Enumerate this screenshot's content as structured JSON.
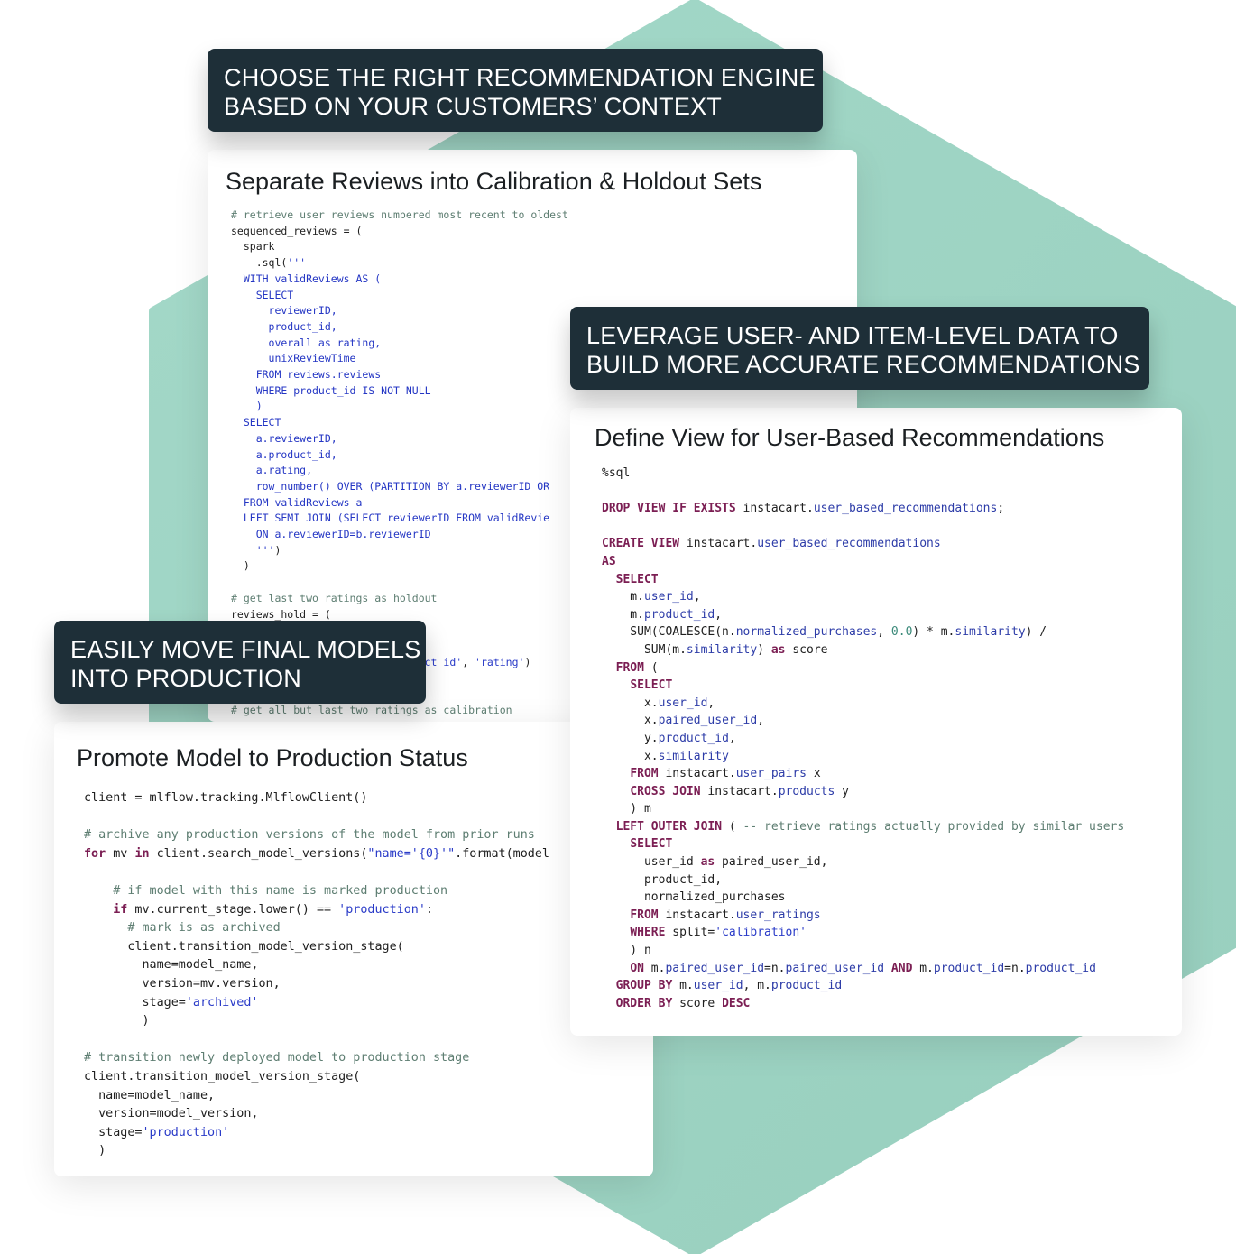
{
  "colors": {
    "hexagon": "#9dd3c3",
    "label_bg": "#1e2f38",
    "label_text": "#ffffff",
    "card_bg": "#ffffff",
    "comment": "#5e7e72",
    "string": "#2a3bc8",
    "keyword": "#7b1e53",
    "identifier": "#2d3ca8"
  },
  "labels": {
    "choose_engine": [
      "CHOOSE THE RIGHT RECOMMENDATION ENGINE",
      "BASED ON YOUR CUSTOMERS’ CONTEXT"
    ],
    "leverage_data": [
      "LEVERAGE USER- AND ITEM-LEVEL DATA TO",
      "BUILD MORE ACCURATE RECOMMENDATIONS"
    ],
    "move_models": [
      "EASILY MOVE FINAL MODELS",
      "INTO PRODUCTION"
    ]
  },
  "cards": {
    "calibration": {
      "title": "Separate Reviews into Calibration & Holdout Sets",
      "lines": [
        [
          [
            "c",
            "# retrieve user reviews numbered most recent to oldest"
          ]
        ],
        [
          [
            "t",
            "sequenced_reviews = ("
          ]
        ],
        [
          [
            "t",
            "  spark"
          ]
        ],
        [
          [
            "t",
            "    .sql("
          ],
          [
            "s",
            "'''"
          ]
        ],
        [
          [
            "sql",
            "  WITH validReviews AS ("
          ]
        ],
        [
          [
            "sql",
            "    SELECT"
          ]
        ],
        [
          [
            "sql",
            "      reviewerID,"
          ]
        ],
        [
          [
            "sql",
            "      product_id,"
          ]
        ],
        [
          [
            "sql",
            "      overall as rating,"
          ]
        ],
        [
          [
            "sql",
            "      unixReviewTime"
          ]
        ],
        [
          [
            "sql",
            "    FROM reviews.reviews"
          ]
        ],
        [
          [
            "sql",
            "    WHERE product_id IS NOT NULL"
          ]
        ],
        [
          [
            "sql",
            "    )"
          ]
        ],
        [
          [
            "sql",
            "  SELECT"
          ]
        ],
        [
          [
            "sql",
            "    a.reviewerID,"
          ]
        ],
        [
          [
            "sql",
            "    a.product_id,"
          ]
        ],
        [
          [
            "sql",
            "    a.rating,"
          ]
        ],
        [
          [
            "sql",
            "    row_number() OVER (PARTITION BY a.reviewerID OR"
          ]
        ],
        [
          [
            "sql",
            "  FROM validReviews a"
          ]
        ],
        [
          [
            "sql",
            "  LEFT SEMI JOIN (SELECT reviewerID FROM validRevie"
          ]
        ],
        [
          [
            "sql",
            "    ON a.reviewerID=b.reviewerID"
          ]
        ],
        [
          [
            "s",
            "    '''"
          ],
          [
            "t",
            ")"
          ]
        ],
        [
          [
            "t",
            "  )"
          ]
        ],
        [
          [
            "t",
            ""
          ]
        ],
        [
          [
            "c",
            "# get last two ratings as holdout"
          ]
        ],
        [
          [
            "t",
            "reviews_hold = ("
          ]
        ],
        [
          [
            "t",
            ""
          ]
        ],
        [
          [
            "t",
            ""
          ]
        ],
        [
          [
            "t",
            "                         "
          ],
          [
            "s",
            "'product_id'"
          ],
          [
            "t",
            ", "
          ],
          [
            "s",
            "'rating'"
          ],
          [
            "t",
            ")"
          ]
        ],
        [
          [
            "t",
            ""
          ]
        ],
        [
          [
            "t",
            ""
          ]
        ],
        [
          [
            "c",
            "# get all but last two ratings as calibration"
          ]
        ]
      ]
    },
    "user_view": {
      "title": "Define View for User-Based Recommendations",
      "lines": [
        [
          [
            "t",
            "%sql"
          ]
        ],
        [
          [
            "t",
            ""
          ]
        ],
        [
          [
            "kw",
            "DROP VIEW IF EXISTS"
          ],
          [
            "t",
            " instacart."
          ],
          [
            "id",
            "user_based_recommendations"
          ],
          [
            "t",
            ";"
          ]
        ],
        [
          [
            "t",
            ""
          ]
        ],
        [
          [
            "kw",
            "CREATE VIEW"
          ],
          [
            "t",
            " instacart."
          ],
          [
            "id",
            "user_based_recommendations"
          ]
        ],
        [
          [
            "kw",
            "AS"
          ]
        ],
        [
          [
            "t",
            "  "
          ],
          [
            "kw",
            "SELECT"
          ]
        ],
        [
          [
            "t",
            "    m."
          ],
          [
            "id",
            "user_id"
          ],
          [
            "t",
            ","
          ]
        ],
        [
          [
            "t",
            "    m."
          ],
          [
            "id",
            "product_id"
          ],
          [
            "t",
            ","
          ]
        ],
        [
          [
            "t",
            "    SUM(COALESCE(n."
          ],
          [
            "id",
            "normalized_purchases"
          ],
          [
            "t",
            ", "
          ],
          [
            "num",
            "0.0"
          ],
          [
            "t",
            ") * m."
          ],
          [
            "id",
            "similarity"
          ],
          [
            "t",
            ") /"
          ]
        ],
        [
          [
            "t",
            "      SUM(m."
          ],
          [
            "id",
            "similarity"
          ],
          [
            "t",
            ") "
          ],
          [
            "kw",
            "as"
          ],
          [
            "t",
            " score"
          ]
        ],
        [
          [
            "t",
            "  "
          ],
          [
            "kw",
            "FROM"
          ],
          [
            "t",
            " ("
          ]
        ],
        [
          [
            "t",
            "    "
          ],
          [
            "kw",
            "SELECT"
          ]
        ],
        [
          [
            "t",
            "      x."
          ],
          [
            "id",
            "user_id"
          ],
          [
            "t",
            ","
          ]
        ],
        [
          [
            "t",
            "      x."
          ],
          [
            "id",
            "paired_user_id"
          ],
          [
            "t",
            ","
          ]
        ],
        [
          [
            "t",
            "      y."
          ],
          [
            "id",
            "product_id"
          ],
          [
            "t",
            ","
          ]
        ],
        [
          [
            "t",
            "      x."
          ],
          [
            "id",
            "similarity"
          ]
        ],
        [
          [
            "t",
            "    "
          ],
          [
            "kw",
            "FROM"
          ],
          [
            "t",
            " instacart."
          ],
          [
            "id",
            "user_pairs"
          ],
          [
            "t",
            " x"
          ]
        ],
        [
          [
            "t",
            "    "
          ],
          [
            "kw",
            "CROSS JOIN"
          ],
          [
            "t",
            " instacart."
          ],
          [
            "id",
            "products"
          ],
          [
            "t",
            " y"
          ]
        ],
        [
          [
            "t",
            "    ) m"
          ]
        ],
        [
          [
            "t",
            "  "
          ],
          [
            "kw",
            "LEFT OUTER JOIN"
          ],
          [
            "t",
            " ( "
          ],
          [
            "c",
            "-- retrieve ratings actually provided by similar users"
          ]
        ],
        [
          [
            "t",
            "    "
          ],
          [
            "kw",
            "SELECT"
          ]
        ],
        [
          [
            "t",
            "      user_id "
          ],
          [
            "kw",
            "as"
          ],
          [
            "t",
            " paired_user_id,"
          ]
        ],
        [
          [
            "t",
            "      product_id,"
          ]
        ],
        [
          [
            "t",
            "      normalized_purchases"
          ]
        ],
        [
          [
            "t",
            "    "
          ],
          [
            "kw",
            "FROM"
          ],
          [
            "t",
            " instacart."
          ],
          [
            "id",
            "user_ratings"
          ]
        ],
        [
          [
            "t",
            "    "
          ],
          [
            "kw",
            "WHERE"
          ],
          [
            "t",
            " split="
          ],
          [
            "s",
            "'calibration'"
          ]
        ],
        [
          [
            "t",
            "    ) n"
          ]
        ],
        [
          [
            "t",
            "    "
          ],
          [
            "kw",
            "ON"
          ],
          [
            "t",
            " m."
          ],
          [
            "id",
            "paired_user_id"
          ],
          [
            "t",
            "=n."
          ],
          [
            "id",
            "paired_user_id"
          ],
          [
            "t",
            " "
          ],
          [
            "kw",
            "AND"
          ],
          [
            "t",
            " m."
          ],
          [
            "id",
            "product_id"
          ],
          [
            "t",
            "=n."
          ],
          [
            "id",
            "product_id"
          ]
        ],
        [
          [
            "t",
            "  "
          ],
          [
            "kw",
            "GROUP BY"
          ],
          [
            "t",
            " m."
          ],
          [
            "id",
            "user_id"
          ],
          [
            "t",
            ", m."
          ],
          [
            "id",
            "product_id"
          ]
        ],
        [
          [
            "t",
            "  "
          ],
          [
            "kw",
            "ORDER BY"
          ],
          [
            "t",
            " score "
          ],
          [
            "kw",
            "DESC"
          ]
        ]
      ]
    },
    "promote": {
      "title": "Promote Model to Production Status",
      "lines": [
        [
          [
            "t",
            "client = mlflow.tracking.MlflowClient()"
          ]
        ],
        [
          [
            "t",
            ""
          ]
        ],
        [
          [
            "c",
            "# archive any production versions of the model from prior runs"
          ]
        ],
        [
          [
            "kw",
            "for"
          ],
          [
            "t",
            " mv "
          ],
          [
            "kw",
            "in"
          ],
          [
            "t",
            " client.search_model_versions("
          ],
          [
            "s",
            "\"name='{0}'\""
          ],
          [
            "t",
            ".format(model"
          ]
        ],
        [
          [
            "t",
            ""
          ]
        ],
        [
          [
            "t",
            "    "
          ],
          [
            "c",
            "# if model with this name is marked production"
          ]
        ],
        [
          [
            "t",
            "    "
          ],
          [
            "kw",
            "if"
          ],
          [
            "t",
            " mv.current_stage.lower() == "
          ],
          [
            "s",
            "'production'"
          ],
          [
            "t",
            ":"
          ]
        ],
        [
          [
            "t",
            "      "
          ],
          [
            "c",
            "# mark is as archived"
          ]
        ],
        [
          [
            "t",
            "      client.transition_model_version_stage("
          ]
        ],
        [
          [
            "t",
            "        name=model_name,"
          ]
        ],
        [
          [
            "t",
            "        version=mv.version,"
          ]
        ],
        [
          [
            "t",
            "        stage="
          ],
          [
            "s",
            "'archived'"
          ]
        ],
        [
          [
            "t",
            "        )"
          ]
        ],
        [
          [
            "t",
            ""
          ]
        ],
        [
          [
            "c",
            "# transition newly deployed model to production stage"
          ]
        ],
        [
          [
            "t",
            "client.transition_model_version_stage("
          ]
        ],
        [
          [
            "t",
            "  name=model_name,"
          ]
        ],
        [
          [
            "t",
            "  version=model_version,"
          ]
        ],
        [
          [
            "t",
            "  stage="
          ],
          [
            "s",
            "'production'"
          ]
        ],
        [
          [
            "t",
            "  )"
          ]
        ]
      ]
    }
  }
}
